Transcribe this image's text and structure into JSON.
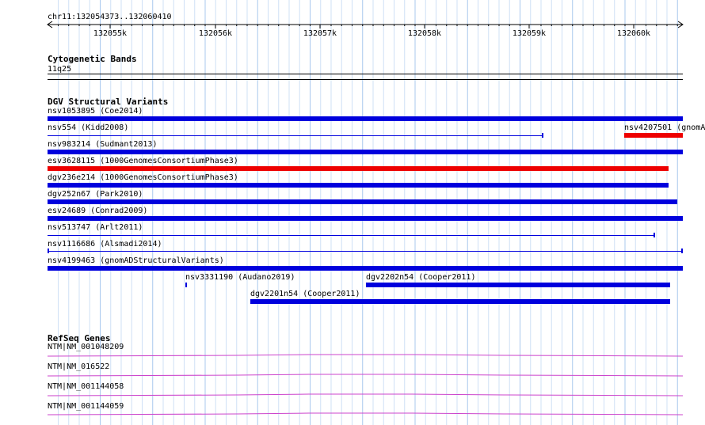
{
  "ruler": {
    "location": "chr11:132054373..132060410",
    "ticks": [
      "132055k",
      "132056k",
      "132057k",
      "132058k",
      "132059k",
      "132060k"
    ]
  },
  "cytoband": {
    "title": "Cytogenetic Bands",
    "band": "11q25"
  },
  "dgv": {
    "title": "DGV Structural Variants",
    "features": [
      {
        "label": "nsv1053895 (Coe2014)",
        "color": "#0000dd",
        "style": "bar"
      },
      {
        "label": "nsv554 (Kidd2008)",
        "color": "#0000dd",
        "style": "thin"
      },
      {
        "label": "nsv4207501 (gnomA",
        "color": "#ee0000",
        "style": "bar"
      },
      {
        "label": "nsv983214 (Sudmant2013)",
        "color": "#0000dd",
        "style": "bar"
      },
      {
        "label": "esv3628115 (1000GenomesConsortiumPhase3)",
        "color": "#ee0000",
        "style": "bar"
      },
      {
        "label": "dgv236e214 (1000GenomesConsortiumPhase3)",
        "color": "#0000dd",
        "style": "bar"
      },
      {
        "label": "dgv252n67 (Park2010)",
        "color": "#0000dd",
        "style": "bar"
      },
      {
        "label": "esv24689 (Conrad2009)",
        "color": "#0000dd",
        "style": "bar"
      },
      {
        "label": "nsv513747 (Arlt2011)",
        "color": "#0000dd",
        "style": "thin"
      },
      {
        "label": "nsv1116686 (Alsmadi2014)",
        "color": "#0000dd",
        "style": "thin"
      },
      {
        "label": "nsv4199463 (gnomADStructuralVariants)",
        "color": "#0000dd",
        "style": "bar"
      },
      {
        "label": "nsv3331190 (Audano2019)",
        "color": "#0000dd",
        "style": "tiny"
      },
      {
        "label": "dgv2202n54 (Cooper2011)",
        "color": "#0000dd",
        "style": "bar"
      },
      {
        "label": "dgv2201n54 (Cooper2011)",
        "color": "#0000dd",
        "style": "bar"
      }
    ]
  },
  "refseq": {
    "title": "RefSeq Genes",
    "color": "#cc44cc",
    "genes": [
      {
        "label": "NTM|NM_001048209"
      },
      {
        "label": "NTM|NM_016522"
      },
      {
        "label": "NTM|NM_001144058"
      },
      {
        "label": "NTM|NM_001144059"
      }
    ]
  }
}
